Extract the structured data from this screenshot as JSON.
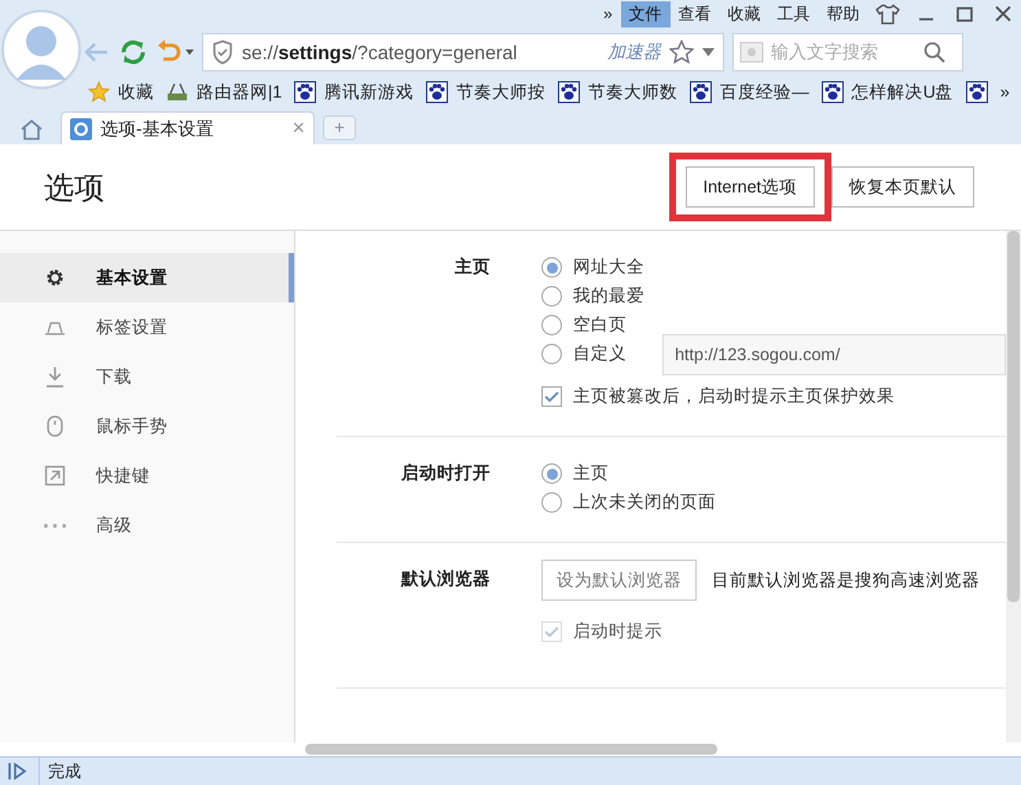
{
  "menu_bar": {
    "overflow": "»",
    "items": [
      {
        "label": "文件",
        "selected": true
      },
      {
        "label": "查看",
        "selected": false
      },
      {
        "label": "收藏",
        "selected": false
      },
      {
        "label": "工具",
        "selected": false
      },
      {
        "label": "帮助",
        "selected": false
      }
    ]
  },
  "address_bar": {
    "url": "se://**settings**/?category=general",
    "accelerator": "加速器"
  },
  "search": {
    "placeholder": "输入文字搜索"
  },
  "bookmarks": [
    {
      "label": "收藏",
      "kind": "star"
    },
    {
      "label": "路由器网|1",
      "kind": "router"
    },
    {
      "label": "腾讯新游戏",
      "kind": "paw"
    },
    {
      "label": "节奏大师按",
      "kind": "paw"
    },
    {
      "label": "节奏大师数",
      "kind": "paw"
    },
    {
      "label": "百度经验—",
      "kind": "paw"
    },
    {
      "label": "怎样解决U盘",
      "kind": "paw"
    },
    {
      "kind": "paw"
    }
  ],
  "bookmarks_overflow": "»",
  "tabs": [
    {
      "label": "选项-基本设置",
      "selected": true,
      "close": "×"
    }
  ],
  "new_tab": "+",
  "page": {
    "title": "选项",
    "buttons": [
      {
        "label": "Internet选项",
        "highlighted": true
      },
      {
        "label": "恢复本页默认",
        "highlighted": false
      }
    ]
  },
  "sidebar": {
    "items": [
      {
        "label": "基本设置",
        "kind": "gear",
        "selected": true
      },
      {
        "label": "标签设置",
        "kind": "tab",
        "selected": false
      },
      {
        "label": "下载",
        "kind": "download",
        "selected": false
      },
      {
        "label": "鼠标手势",
        "kind": "mouse",
        "selected": false
      },
      {
        "label": "快捷键",
        "kind": "shortcut",
        "selected": false
      },
      {
        "label": "高级",
        "kind": "more",
        "selected": false
      }
    ]
  },
  "sections": [
    {
      "label": "主页",
      "items": [
        {
          "kind": "radio",
          "label": "网址大全",
          "selected": true
        },
        {
          "kind": "radio",
          "label": "我的最爱",
          "selected": false
        },
        {
          "kind": "radio",
          "label": "空白页",
          "selected": false
        },
        {
          "kind": "radio",
          "label": "自定义",
          "selected": false,
          "value": "http://123.sogou.com/"
        },
        {
          "kind": "checkbox",
          "label": "主页被篡改后，启动时提示主页保护效果",
          "checked": true,
          "disabled": false
        }
      ]
    },
    {
      "label": "启动时打开",
      "items": [
        {
          "kind": "radio",
          "label": "主页",
          "selected": true
        },
        {
          "kind": "radio",
          "label": "上次未关闭的页面",
          "selected": false
        }
      ]
    },
    {
      "label": "默认浏览器",
      "items": [
        {
          "kind": "button",
          "label": "设为默认浏览器",
          "note": "目前默认浏览器是搜狗高速浏览器"
        },
        {
          "kind": "checkbox",
          "label": "启动时提示",
          "checked": true,
          "disabled": true
        }
      ]
    }
  ],
  "status_bar": {
    "text": "完成"
  }
}
